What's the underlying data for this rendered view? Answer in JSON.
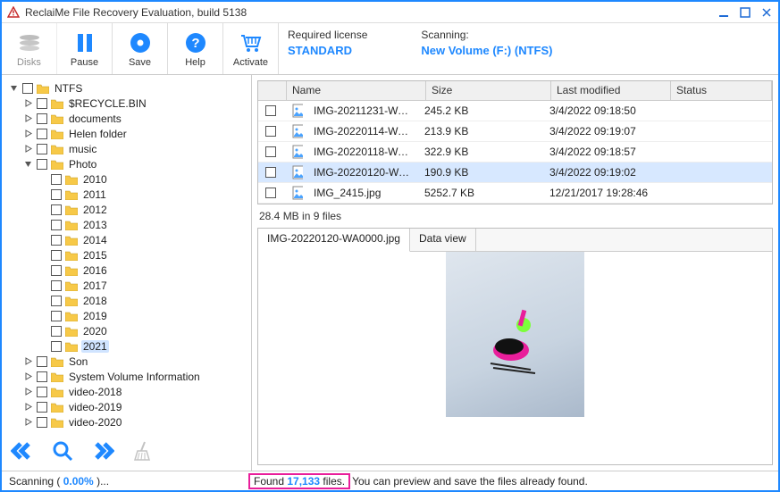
{
  "window": {
    "title": "ReclaiMe File Recovery Evaluation, build 5138"
  },
  "toolbar": {
    "disks": "Disks",
    "pause": "Pause",
    "save": "Save",
    "help": "Help",
    "activate": "Activate",
    "license_hdr": "Required license",
    "license_val": "STANDARD",
    "scanning_hdr": "Scanning:",
    "scanning_val": "New Volume (F:) (NTFS)"
  },
  "tree": {
    "root": "NTFS",
    "items1": [
      "$RECYCLE.BIN",
      "documents",
      "Helen folder",
      "music"
    ],
    "photo": "Photo",
    "years": [
      "2010",
      "2011",
      "2012",
      "2013",
      "2014",
      "2015",
      "2016",
      "2017",
      "2018",
      "2019",
      "2020",
      "2021"
    ],
    "selected_year": "2021",
    "items2": [
      "Son",
      "System Volume Information",
      "video-2018",
      "video-2019",
      "video-2020"
    ]
  },
  "columns": {
    "name": "Name",
    "size": "Size",
    "modified": "Last modified",
    "status": "Status"
  },
  "files": [
    {
      "name": "IMG-20211231-WA00...",
      "size": "245.2 KB",
      "mod": "3/4/2022 09:18:50",
      "sel": false
    },
    {
      "name": "IMG-20220114-WA00...",
      "size": "213.9 KB",
      "mod": "3/4/2022 09:19:07",
      "sel": false
    },
    {
      "name": "IMG-20220118-WA00...",
      "size": "322.9 KB",
      "mod": "3/4/2022 09:18:57",
      "sel": false
    },
    {
      "name": "IMG-20220120-WA00...",
      "size": "190.9 KB",
      "mod": "3/4/2022 09:19:02",
      "sel": true
    },
    {
      "name": "IMG_2415.jpg",
      "size": "5252.7 KB",
      "mod": "12/21/2017 19:28:46",
      "sel": false
    }
  ],
  "summary": "28.4 MB in 9 files",
  "preview_tabs": {
    "tab1": "IMG-20220120-WA0000.jpg",
    "tab2": "Data view"
  },
  "status": {
    "scan_prefix": "Scanning ( ",
    "scan_pct": "0.00%",
    "scan_suffix": " )...",
    "found_prefix": "Found ",
    "found_count": "17,133",
    "found_suffix": " files.",
    "rest": "You can preview and save the files already found."
  }
}
